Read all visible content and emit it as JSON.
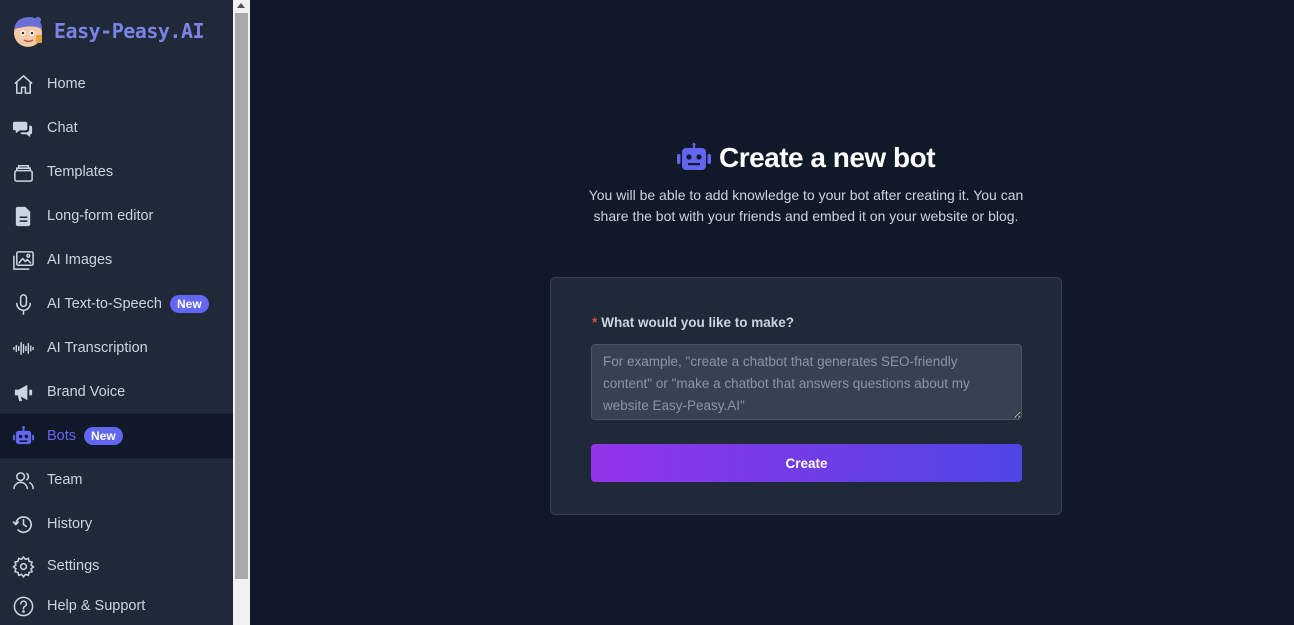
{
  "app": {
    "brand": "Easy-Peasy.AI",
    "accent": "#6366f1"
  },
  "sidebar": {
    "items": [
      {
        "label": "Home",
        "icon": "home-icon"
      },
      {
        "label": "Chat",
        "icon": "chat-icon"
      },
      {
        "label": "Templates",
        "icon": "templates-icon"
      },
      {
        "label": "Long-form editor",
        "icon": "document-icon"
      },
      {
        "label": "AI Images",
        "icon": "images-icon"
      },
      {
        "label": "AI Text-to-Speech",
        "icon": "microphone-icon",
        "badge": "New"
      },
      {
        "label": "AI Transcription",
        "icon": "waveform-icon"
      },
      {
        "label": "Brand Voice",
        "icon": "megaphone-icon"
      },
      {
        "label": "Bots",
        "icon": "robot-icon",
        "badge": "New",
        "active": true
      },
      {
        "label": "Team",
        "icon": "team-icon"
      },
      {
        "label": "History",
        "icon": "history-icon"
      },
      {
        "label": "Settings",
        "icon": "gear-icon"
      },
      {
        "label": "Help & Support",
        "icon": "help-icon"
      }
    ]
  },
  "main": {
    "title": "Create a new bot",
    "title_icon": "robot-icon",
    "subtitle": "You will be able to add knowledge to your bot after creating it. You can share the bot with your friends and embed it on your website or blog.",
    "form": {
      "required_mark": "*",
      "label": "What would you like to make?",
      "value": "",
      "placeholder": "For example, \"create a chatbot that generates SEO-friendly content\" or \"make a chatbot that answers questions about my website Easy-Peasy.AI\"",
      "button_label": "Create"
    }
  }
}
